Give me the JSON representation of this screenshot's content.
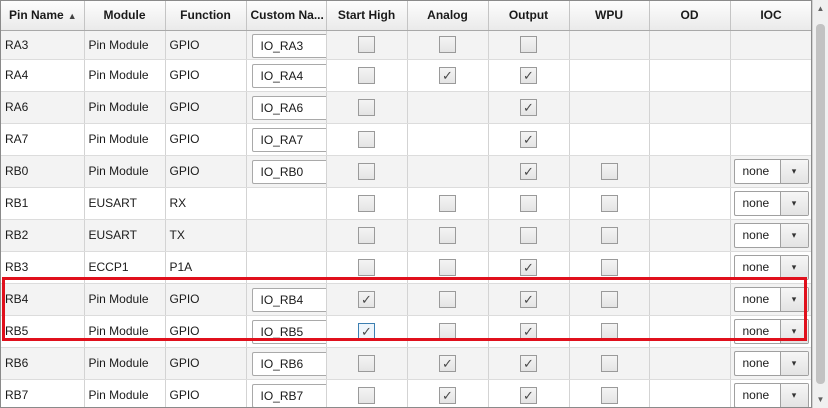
{
  "columns": {
    "pin_name": "Pin Name",
    "module": "Module",
    "function": "Function",
    "custom_name": "Custom Na...",
    "start_high": "Start High",
    "analog": "Analog",
    "output": "Output",
    "wpu": "WPU",
    "od": "OD",
    "ioc": "IOC"
  },
  "sort": {
    "column": "pin_name",
    "direction": "ascending",
    "icon": "sort-ascending-icon"
  },
  "rows": [
    {
      "pin": "RA3",
      "module": "Pin Module",
      "function": "GPIO",
      "custom_name": "IO_RA3",
      "start_high": false,
      "analog": false,
      "output": false,
      "wpu": null,
      "od": null,
      "ioc": null
    },
    {
      "pin": "RA4",
      "module": "Pin Module",
      "function": "GPIO",
      "custom_name": "IO_RA4",
      "start_high": false,
      "analog": true,
      "output": true,
      "wpu": null,
      "od": null,
      "ioc": null
    },
    {
      "pin": "RA6",
      "module": "Pin Module",
      "function": "GPIO",
      "custom_name": "IO_RA6",
      "start_high": false,
      "analog": null,
      "output": true,
      "wpu": null,
      "od": null,
      "ioc": null
    },
    {
      "pin": "RA7",
      "module": "Pin Module",
      "function": "GPIO",
      "custom_name": "IO_RA7",
      "start_high": false,
      "analog": null,
      "output": true,
      "wpu": null,
      "od": null,
      "ioc": null
    },
    {
      "pin": "RB0",
      "module": "Pin Module",
      "function": "GPIO",
      "custom_name": "IO_RB0",
      "start_high": false,
      "analog": null,
      "output": true,
      "wpu": false,
      "od": null,
      "ioc": "none"
    },
    {
      "pin": "RB1",
      "module": "EUSART",
      "function": "RX",
      "custom_name": null,
      "start_high": false,
      "analog": false,
      "output": false,
      "wpu": false,
      "od": null,
      "ioc": "none"
    },
    {
      "pin": "RB2",
      "module": "EUSART",
      "function": "TX",
      "custom_name": null,
      "start_high": false,
      "analog": false,
      "output": false,
      "wpu": false,
      "od": null,
      "ioc": "none"
    },
    {
      "pin": "RB3",
      "module": "ECCP1",
      "function": "P1A",
      "custom_name": null,
      "start_high": false,
      "analog": false,
      "output": true,
      "wpu": false,
      "od": null,
      "ioc": "none"
    },
    {
      "pin": "RB4",
      "module": "Pin Module",
      "function": "GPIO",
      "custom_name": "IO_RB4",
      "start_high": true,
      "analog": false,
      "output": true,
      "wpu": false,
      "od": null,
      "ioc": "none"
    },
    {
      "pin": "RB5",
      "module": "Pin Module",
      "function": "GPIO",
      "custom_name": "IO_RB5",
      "start_high": true,
      "analog": false,
      "output": true,
      "wpu": false,
      "od": null,
      "ioc": "none",
      "focused": "start_high"
    },
    {
      "pin": "RB6",
      "module": "Pin Module",
      "function": "GPIO",
      "custom_name": "IO_RB6",
      "start_high": false,
      "analog": true,
      "output": true,
      "wpu": false,
      "od": null,
      "ioc": "none"
    },
    {
      "pin": "RB7",
      "module": "Pin Module",
      "function": "GPIO",
      "custom_name": "IO_RB7",
      "start_high": false,
      "analog": true,
      "output": true,
      "wpu": false,
      "od": null,
      "ioc": "none"
    }
  ],
  "highlight": {
    "rows": [
      "RB4",
      "RB5"
    ],
    "color": "#e0101c"
  },
  "icons": {
    "dropdown": "chevron-down-icon",
    "checkmark": "checkmark-icon"
  },
  "glyphs": {
    "check": "✓",
    "sort_up": "▲",
    "dropdown": "▾",
    "scroll_up": "▲",
    "scroll_down": "▼"
  }
}
